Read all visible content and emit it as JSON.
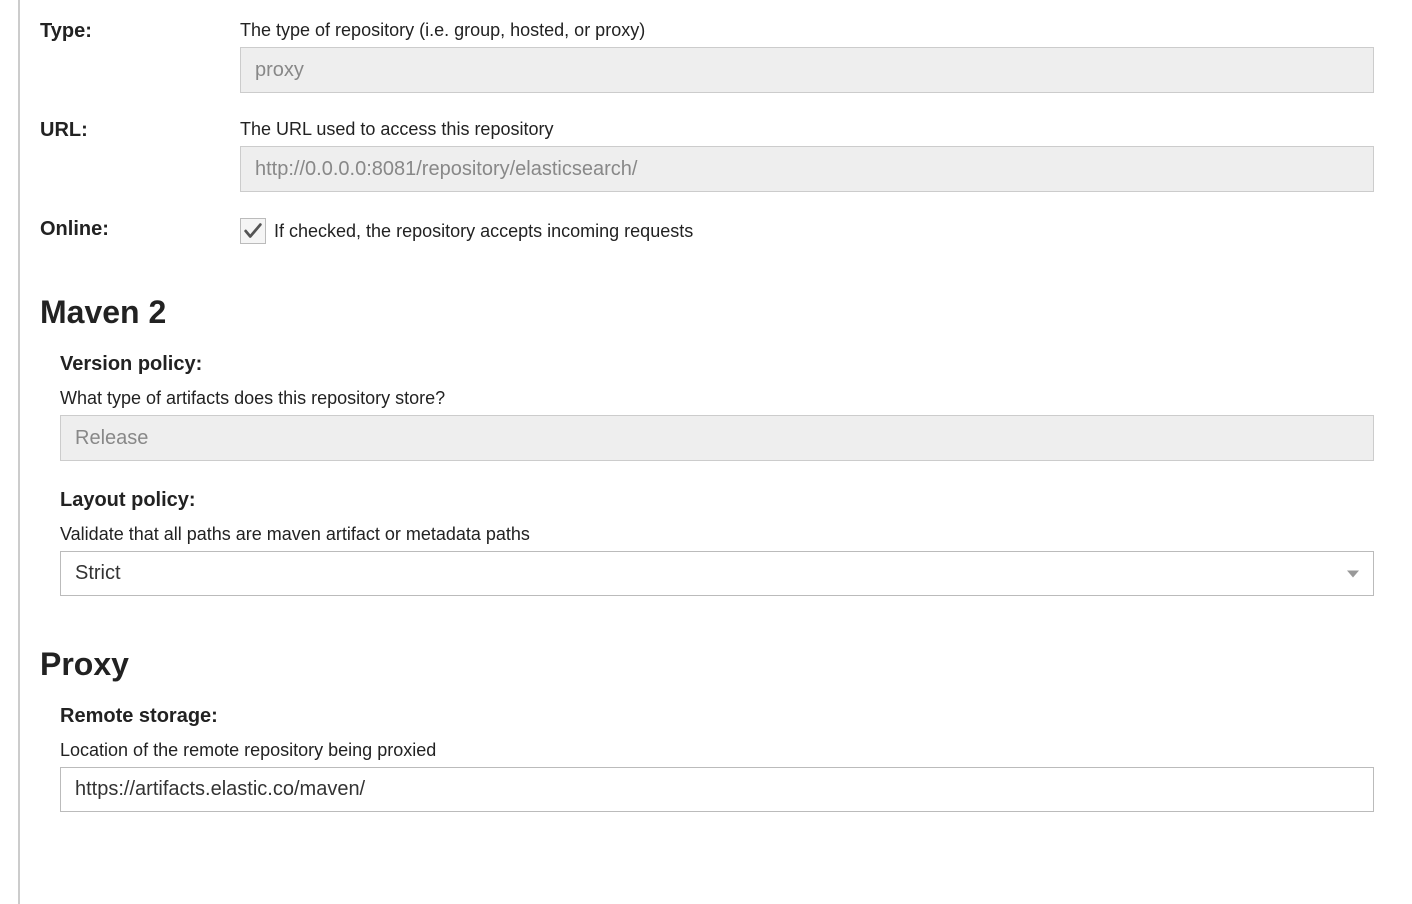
{
  "top": {
    "type": {
      "label": "Type:",
      "help": "The type of repository (i.e. group, hosted, or proxy)",
      "value": "proxy"
    },
    "url": {
      "label": "URL:",
      "help": "The URL used to access this repository",
      "value": "http://0.0.0.0:8081/repository/elasticsearch/"
    },
    "online": {
      "label": "Online:",
      "help": "If checked, the repository accepts incoming requests",
      "checked": true
    }
  },
  "maven2": {
    "title": "Maven 2",
    "version_policy": {
      "label": "Version policy:",
      "help": "What type of artifacts does this repository store?",
      "value": "Release"
    },
    "layout_policy": {
      "label": "Layout policy:",
      "help": "Validate that all paths are maven artifact or metadata paths",
      "value": "Strict"
    }
  },
  "proxy": {
    "title": "Proxy",
    "remote_storage": {
      "label": "Remote storage:",
      "help": "Location of the remote repository being proxied",
      "value": "https://artifacts.elastic.co/maven/"
    }
  }
}
